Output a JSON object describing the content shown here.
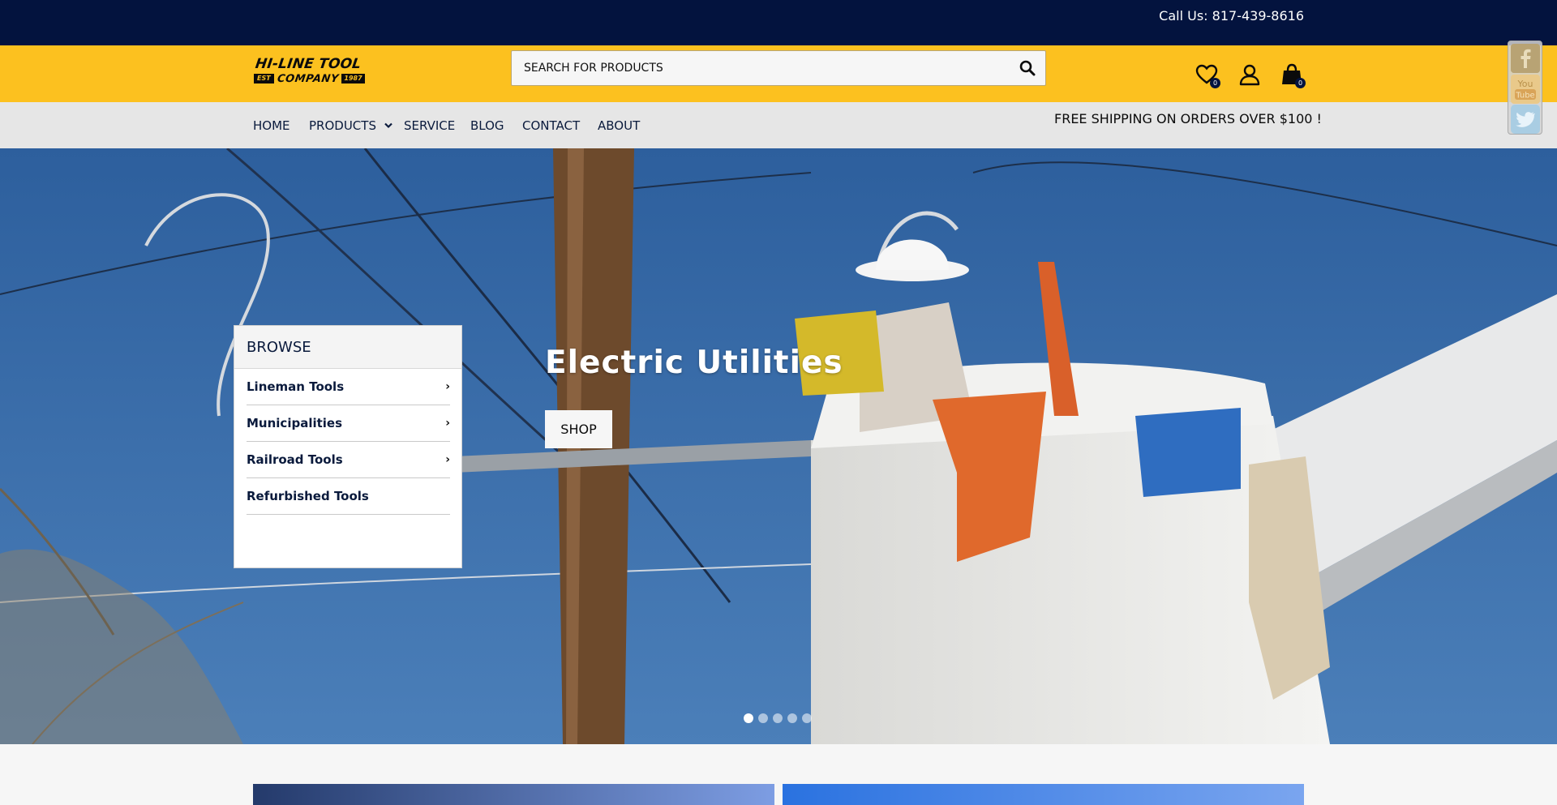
{
  "topbar": {
    "phone_text": "Call Us: 817-439-8616"
  },
  "header": {
    "logo": {
      "line1": "HI-LINE TOOL",
      "est": "EST",
      "line2": "COMPANY",
      "year": "1987"
    },
    "search": {
      "placeholder": "SEARCH FOR PRODUCTS",
      "value": ""
    },
    "wishlist_count": "0",
    "cart_count": "0"
  },
  "nav": {
    "items": [
      {
        "label": "HOME"
      },
      {
        "label": "PRODUCTS"
      },
      {
        "label": "SERVICE"
      },
      {
        "label": "BLOG"
      },
      {
        "label": "CONTACT"
      },
      {
        "label": "ABOUT"
      }
    ],
    "promo": "FREE SHIPPING ON ORDERS OVER $100 !"
  },
  "browse": {
    "title": "BROWSE",
    "items": [
      {
        "label": "Lineman Tools",
        "has_arrow": true
      },
      {
        "label": "Municipalities",
        "has_arrow": true
      },
      {
        "label": "Railroad Tools",
        "has_arrow": true
      },
      {
        "label": "Refurbished Tools",
        "has_arrow": false
      }
    ]
  },
  "hero": {
    "title": "Electric Utilities",
    "button_label": "SHOP",
    "slides_total": 5,
    "active_slide": 1
  },
  "social": {
    "items": [
      {
        "icon": "facebook-icon",
        "label": "f"
      },
      {
        "icon": "youtube-icon",
        "label": "YouTube"
      },
      {
        "icon": "twitter-icon",
        "label": ""
      }
    ]
  },
  "colors": {
    "topbar": "#03133e",
    "header": "#fcc11f",
    "nav": "#e6e6e6",
    "text_dark": "#0a1a3c"
  }
}
